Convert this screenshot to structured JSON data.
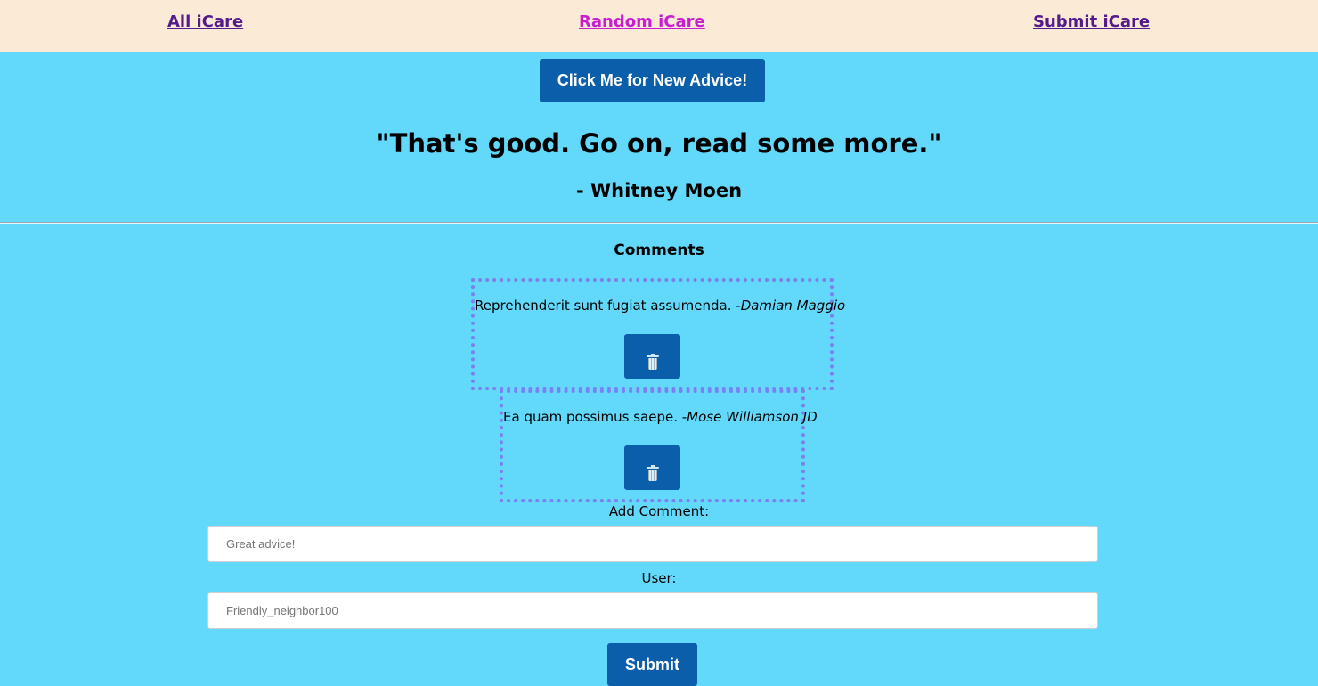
{
  "nav": {
    "all_label": "All iCare",
    "random_label": "Random iCare",
    "submit_label": "Submit iCare"
  },
  "advice": {
    "button_label": "Click Me for New Advice!",
    "quote": "\"That's good. Go on, read some more.\"",
    "author": "- Whitney Moen"
  },
  "comments": {
    "heading": "Comments",
    "items": [
      {
        "text": "Reprehenderit sunt fugiat assumenda. -",
        "author": "Damian Maggio",
        "delete_icon": "trash-icon"
      },
      {
        "text": "Ea quam possimus saepe. -",
        "author": "Mose Williamson JD",
        "delete_icon": "trash-icon"
      }
    ]
  },
  "form": {
    "comment_label": "Add Comment:",
    "comment_placeholder": "Great advice!",
    "user_label": "User:",
    "user_placeholder": "Friendly_neighbor100",
    "submit_label": "Submit"
  },
  "colors": {
    "nav_background": "#fbead6",
    "page_background": "#62d9fb",
    "button": "#0b5ea9",
    "link": "#551a8b",
    "active_link": "#c81ed0",
    "comment_border": "#7b7ff1"
  }
}
